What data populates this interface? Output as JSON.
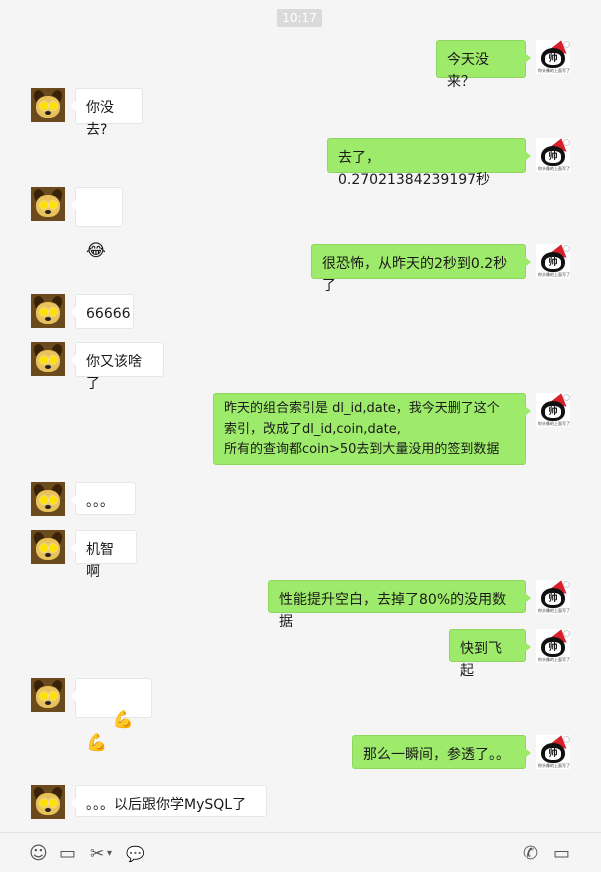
{
  "chat": {
    "timestamp": "10:17",
    "messages": [
      {
        "side": "out",
        "text": "今天没来？"
      },
      {
        "side": "in",
        "text": "你没去?"
      },
      {
        "side": "out",
        "text": "去了，0.27021384239197秒"
      },
      {
        "side": "in",
        "text": "",
        "emoji": "😂"
      },
      {
        "side": "out",
        "text": "很恐怖，从昨天的2秒到0.2秒了"
      },
      {
        "side": "in",
        "text": "66666"
      },
      {
        "side": "in",
        "text": "你又该啥了"
      },
      {
        "side": "out",
        "text": "昨天的组合索引是 dl_id,date，我今天删了这个\n索引，改成了dl_id,coin,date,\n所有的查询都coin>50去到大量没用的签到数据"
      },
      {
        "side": "in",
        "text": "。。。"
      },
      {
        "side": "in",
        "text": "机智啊"
      },
      {
        "side": "out",
        "text": "性能提升空白，去掉了80%的没用数据"
      },
      {
        "side": "out",
        "text": "快到飞起"
      },
      {
        "side": "in",
        "text": "",
        "emoji": "💪 💪"
      },
      {
        "side": "out",
        "text": "那么一瞬间，参透了。。"
      },
      {
        "side": "in",
        "text": "。。。以后跟你学MySQL了"
      }
    ]
  },
  "avatars": {
    "self_char": "帅",
    "self_caption": "你头像的上面写了什么"
  },
  "toolbar": {
    "icons": [
      "emoji-icon",
      "folder-icon",
      "scissors-icon",
      "chat-history-icon",
      "phone-icon",
      "video-icon"
    ],
    "emoji_glyph": "☺",
    "folder_glyph": "▭",
    "scissors_glyph": "✂",
    "dropdown_glyph": "▾",
    "chat_glyph": "💬",
    "phone_glyph": "✆",
    "video_glyph": "▭"
  }
}
